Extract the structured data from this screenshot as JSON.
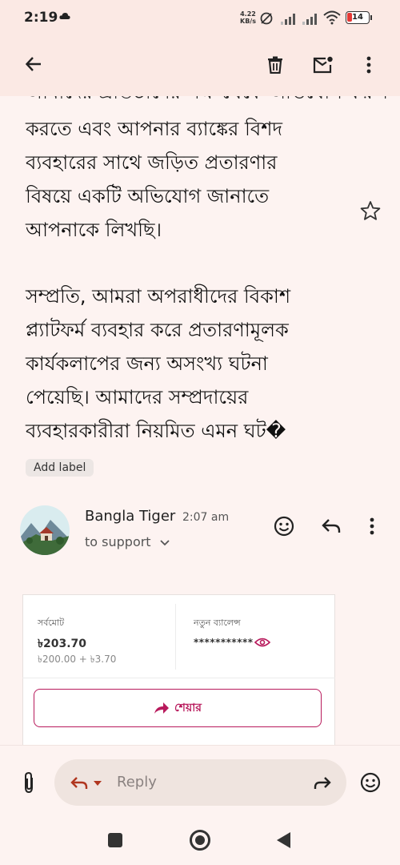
{
  "status_bar": {
    "time": "2:19",
    "net_speed_value": "4.22",
    "net_speed_unit": "KB/s",
    "battery": "14",
    "icons": [
      "cloud-icon",
      "data-saver-icon",
      "signal-icon",
      "signal-icon",
      "wifi-icon",
      "battery-icon"
    ]
  },
  "app_bar": {
    "icons": [
      "back-arrow-icon",
      "delete-icon",
      "mark-unread-icon",
      "more-vert-icon"
    ]
  },
  "email": {
    "cut_line": "আমাদের প্রতিষ্ঠানের পক্ষ থেকে অভিযোগ করুন",
    "paragraph1": [
      "করতে এবং আপনার ব্যাঙ্কের বিশদ",
      "ব্যবহারের সাথে জড়িত প্রতারণার",
      "বিষয়ে একটি অভিযোগ জানাতে",
      "আপনাকে লিখছি।"
    ],
    "paragraph2": [
      "সম্প্রতি, আমরা অপরাধীদের বিকাশ",
      "প্ল্যাটফর্ম ব্যবহার করে প্রতারণামূলক",
      "কার্যকলাপের জন্য অসংখ্য ঘটনা",
      "পেয়েছি। আমাদের সম্প্রদায়ের",
      "ব্যবহারকারীরা নিয়মিত এমন ঘট�"
    ],
    "add_label": "Add label"
  },
  "reply_message": {
    "sender_name": "Bangla Tiger",
    "time": "2:07 am",
    "to_line": "to support"
  },
  "card": {
    "total_label": "সর্বমোট",
    "total_value": "৳203.70",
    "total_breakdown": "৳200.00 + ৳3.70",
    "new_balance_label": "নতুন ব্যালেন্স",
    "new_balance_value": "***********",
    "share_label": "শেয়ার"
  },
  "reply_bar": {
    "placeholder": "Reply"
  },
  "colors": {
    "accent": "#b81a5c",
    "background": "#fdf3f1",
    "appbar": "#fbe9e4"
  }
}
